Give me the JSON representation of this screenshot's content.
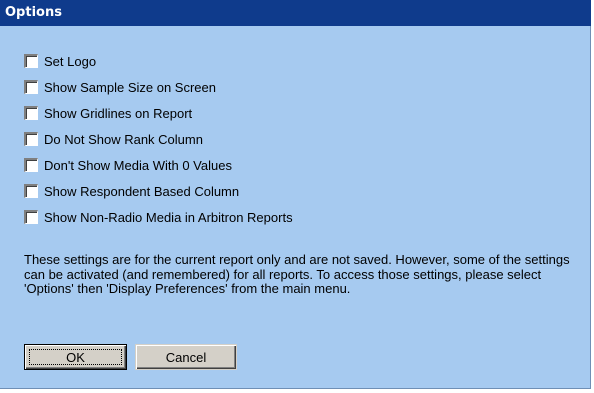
{
  "dialog": {
    "title": "Options",
    "background_color": "#a6caf0",
    "titlebar_color": "#0f3b8c"
  },
  "options": [
    {
      "label": "Set Logo",
      "checked": false
    },
    {
      "label": "Show Sample Size on Screen",
      "checked": false
    },
    {
      "label": "Show Gridlines on Report",
      "checked": false
    },
    {
      "label": "Do Not Show Rank Column",
      "checked": false
    },
    {
      "label": "Don't Show Media With 0 Values",
      "checked": false
    },
    {
      "label": "Show Respondent Based Column",
      "checked": false
    },
    {
      "label": "Show Non-Radio Media in Arbitron Reports",
      "checked": false
    }
  ],
  "info_text": "These settings are for the current report only and are not saved.  However, some of the settings can be activated (and remembered) for all reports.  To access those settings, please select 'Options' then 'Display Preferences' from the main menu.",
  "buttons": {
    "ok_label": "OK",
    "cancel_label": "Cancel"
  }
}
